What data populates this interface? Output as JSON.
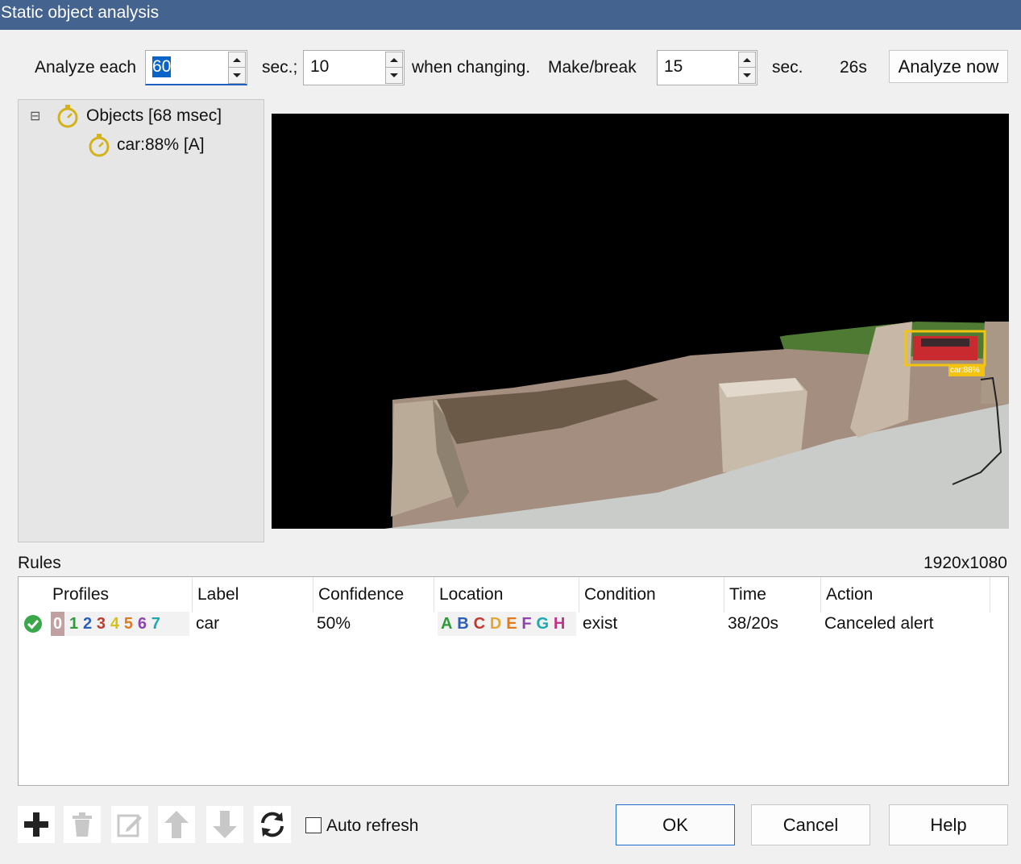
{
  "window": {
    "title": "Static object analysis"
  },
  "top": {
    "analyze_each_label": "Analyze each",
    "analyze_each_value": "60",
    "sec1_label": "sec.;",
    "changing_value": "10",
    "when_changing_label": "when changing.",
    "make_break_label": "Make/break",
    "make_break_value": "15",
    "sec2_label": "sec.",
    "elapsed": "26s",
    "analyze_now_label": "Analyze now"
  },
  "tree": {
    "expander": "⊟",
    "root_label": "Objects [68 msec]",
    "child_label": "car:88% [A]",
    "icon": "stopwatch-icon"
  },
  "video": {
    "detection_label": "car:88%",
    "resolution": "1920x1080",
    "box_color": "#f2c40f"
  },
  "rules": {
    "section_label": "Rules",
    "headers": [
      "Profiles",
      "Label",
      "Confidence",
      "Location",
      "Condition",
      "Time",
      "Action"
    ],
    "rows": [
      {
        "enabled_icon": "check-circle-icon",
        "profiles": [
          "0",
          "1",
          "2",
          "3",
          "4",
          "5",
          "6",
          "7"
        ],
        "label": "car",
        "confidence": "50%",
        "locations": [
          "A",
          "B",
          "C",
          "D",
          "E",
          "F",
          "G",
          "H"
        ],
        "condition": "exist",
        "time": "38/20s",
        "action": "Canceled alert"
      }
    ],
    "profile_colors": [
      "#c0a0a0",
      "#2e9a3a",
      "#2b5fb8",
      "#c0392b",
      "#d8c21a",
      "#e07a1a",
      "#8e44ad",
      "#1aaab0"
    ],
    "location_colors": [
      "#2e9a3a",
      "#2b5fb8",
      "#c0392b",
      "#e0a83a",
      "#e07a1a",
      "#8e44ad",
      "#1aaab0",
      "#c2348a"
    ]
  },
  "bottom": {
    "auto_refresh_label": "Auto refresh",
    "auto_refresh_checked": false,
    "ok_label": "OK",
    "cancel_label": "Cancel",
    "help_label": "Help",
    "tools": [
      "add-icon",
      "delete-icon",
      "edit-icon",
      "move-up-icon",
      "move-down-icon",
      "refresh-icon"
    ]
  }
}
